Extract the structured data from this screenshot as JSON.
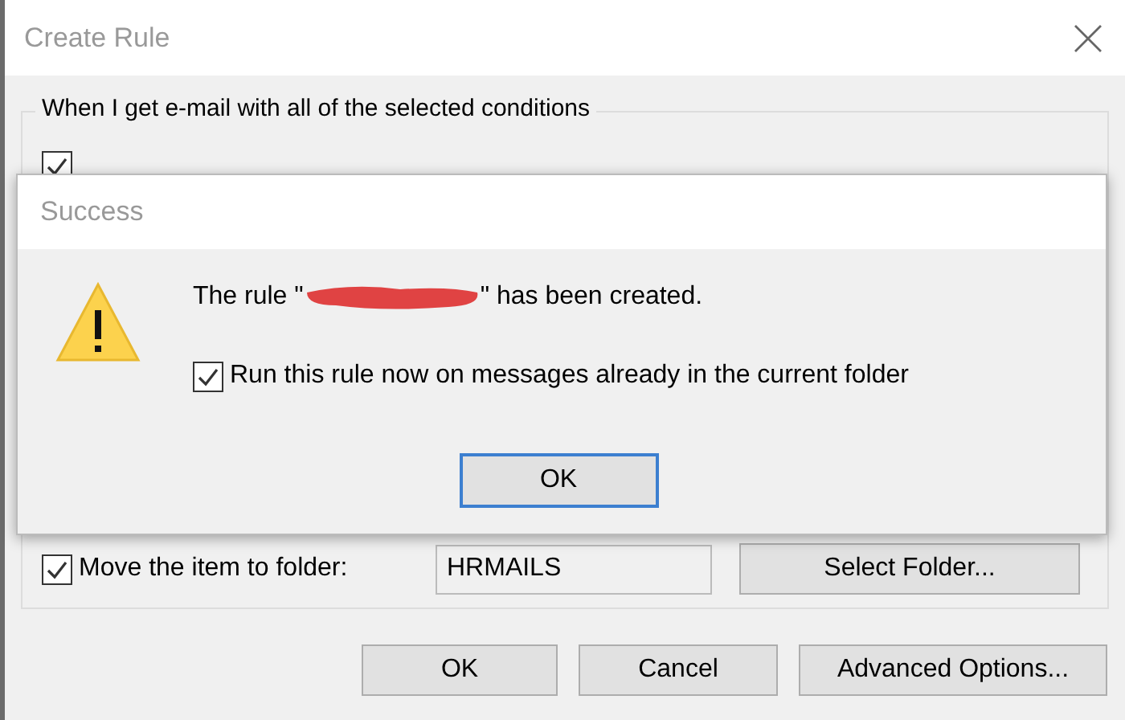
{
  "window": {
    "title": "Create Rule"
  },
  "conditions": {
    "heading": "When I get e-mail with all of the selected conditions",
    "items": [
      {
        "checked": true
      }
    ]
  },
  "action": {
    "label": "Move the item to folder:",
    "checked": true,
    "folder": "HRMAILS",
    "button": "Select Folder..."
  },
  "buttons": [
    "OK",
    "Cancel",
    "Advanced Options..."
  ],
  "dialog": {
    "title": "Success",
    "message_before": "The rule \"",
    "message_after": "\" has been created.",
    "redacted": true,
    "option": {
      "label": "Run this rule now on messages already in the current folder",
      "checked": true
    },
    "button": "OK"
  }
}
